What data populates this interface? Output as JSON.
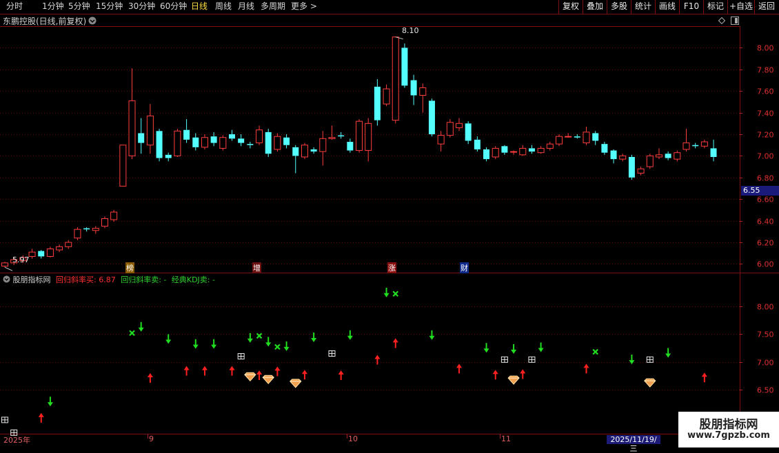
{
  "toolbar": {
    "left_items": [
      "分时",
      "1分钟",
      "5分钟",
      "15分钟",
      "30分钟",
      "60分钟",
      "日线",
      "周线",
      "月线",
      "多周期",
      "更多 >"
    ],
    "active": "日线",
    "right_items": [
      "复权",
      "叠加",
      "多股",
      "统计",
      "画线",
      "F10",
      "标记",
      "+自选",
      "返回"
    ]
  },
  "panel": {
    "title": "东鹏控股(日线,前复权)",
    "high_label": "8.10",
    "low_label": "5.97",
    "current_price_tag": "6.55",
    "event_markers": [
      {
        "text": "榜",
        "bg": "#8a5a00"
      },
      {
        "text": "增",
        "bg": "#6a1010"
      },
      {
        "text": "涨",
        "bg": "#8a1010"
      },
      {
        "text": "财",
        "bg": "#102a8a"
      }
    ]
  },
  "indicator": {
    "name": "股朋指标网",
    "buy_label": "回归斜率买: 6.87",
    "sell_label": "回归斜率卖: -",
    "kdj_label": "经典KDJ卖: -",
    "buy_color": "#ff3030",
    "sell_color": "#30d030"
  },
  "axis": {
    "date_labels": [
      "2025年",
      "9",
      "10",
      "11"
    ],
    "date_tag": "2025/11/19/三"
  },
  "watermark": {
    "line1": "股朋指标网",
    "line2": "www.7gpzb.com"
  },
  "chart_data": {
    "type": "candlestick",
    "title": "东鹏控股(日线,前复权)",
    "y_ticks": [
      8.0,
      7.8,
      7.6,
      7.4,
      7.2,
      7.0,
      6.8,
      6.6,
      6.4,
      6.2,
      6.0
    ],
    "ylim": [
      5.92,
      8.2
    ],
    "ind_y_ticks": [
      8.0,
      7.5,
      7.0,
      6.5
    ],
    "ind_ylim": [
      5.7,
      8.6
    ],
    "colors": {
      "up": "#ff3d3d",
      "down": "#54ffff"
    },
    "candles": [
      [
        5.98,
        6.01,
        6.02,
        5.97
      ],
      [
        6.01,
        6.04,
        6.06,
        5.99
      ],
      [
        6.03,
        6.06,
        6.08,
        6.01
      ],
      [
        6.07,
        6.11,
        6.14,
        6.05
      ],
      [
        6.12,
        6.07,
        6.13,
        6.05
      ],
      [
        6.07,
        6.14,
        6.16,
        6.06
      ],
      [
        6.13,
        6.16,
        6.18,
        6.11
      ],
      [
        6.16,
        6.2,
        6.22,
        6.14
      ],
      [
        6.24,
        6.32,
        6.34,
        6.22
      ],
      [
        6.33,
        6.32,
        6.34,
        6.3
      ],
      [
        6.31,
        6.33,
        6.35,
        6.28
      ],
      [
        6.35,
        6.42,
        6.44,
        6.33
      ],
      [
        6.41,
        6.48,
        6.5,
        6.39
      ],
      [
        6.72,
        7.1,
        7.1,
        6.72
      ],
      [
        7.0,
        7.51,
        7.81,
        6.97
      ],
      [
        7.21,
        7.12,
        7.35,
        7.02
      ],
      [
        7.1,
        7.37,
        7.48,
        7.02
      ],
      [
        7.23,
        6.98,
        7.25,
        6.95
      ],
      [
        7.01,
        6.98,
        7.03,
        6.95
      ],
      [
        7.0,
        7.23,
        7.25,
        6.99
      ],
      [
        7.24,
        7.15,
        7.34,
        7.12
      ],
      [
        7.17,
        7.08,
        7.21,
        7.05
      ],
      [
        7.08,
        7.17,
        7.2,
        7.06
      ],
      [
        7.18,
        7.12,
        7.22,
        7.09
      ],
      [
        7.07,
        7.17,
        7.19,
        7.05
      ],
      [
        7.2,
        7.16,
        7.24,
        7.14
      ],
      [
        7.16,
        7.12,
        7.2,
        7.09
      ],
      [
        7.11,
        7.1,
        7.13,
        7.07
      ],
      [
        7.12,
        7.24,
        7.28,
        7.1
      ],
      [
        7.22,
        7.02,
        7.25,
        6.99
      ],
      [
        7.06,
        7.18,
        7.21,
        7.04
      ],
      [
        7.17,
        7.1,
        7.2,
        7.07
      ],
      [
        7.08,
        7.0,
        7.1,
        6.84
      ],
      [
        6.99,
        7.1,
        7.12,
        6.97
      ],
      [
        7.06,
        7.04,
        7.08,
        7.02
      ],
      [
        7.04,
        7.16,
        7.23,
        6.91
      ],
      [
        7.16,
        7.17,
        7.28,
        7.15
      ],
      [
        7.19,
        7.18,
        7.22,
        7.16
      ],
      [
        7.13,
        7.05,
        7.16,
        7.03
      ],
      [
        7.05,
        7.32,
        7.34,
        7.03
      ],
      [
        7.05,
        7.3,
        7.35,
        6.95
      ],
      [
        7.64,
        7.33,
        7.71,
        7.28
      ],
      [
        7.48,
        7.62,
        7.66,
        7.46
      ],
      [
        7.33,
        8.1,
        8.1,
        7.3
      ],
      [
        8.0,
        7.65,
        8.04,
        7.63
      ],
      [
        7.7,
        7.56,
        7.75,
        7.47
      ],
      [
        7.56,
        7.63,
        7.67,
        7.4
      ],
      [
        7.51,
        7.2,
        7.53,
        7.18
      ],
      [
        7.11,
        7.19,
        7.23,
        7.04
      ],
      [
        7.19,
        7.31,
        7.34,
        7.17
      ],
      [
        7.26,
        7.3,
        7.35,
        7.23
      ],
      [
        7.3,
        7.14,
        7.32,
        7.11
      ],
      [
        7.15,
        7.06,
        7.18,
        7.04
      ],
      [
        7.06,
        6.97,
        7.08,
        6.95
      ],
      [
        6.99,
        7.07,
        7.09,
        6.97
      ],
      [
        7.09,
        7.03,
        7.1,
        7.01
      ],
      [
        7.04,
        7.04,
        7.05,
        7.01
      ],
      [
        7.01,
        7.07,
        7.1,
        7.0
      ],
      [
        7.07,
        7.04,
        7.1,
        7.02
      ],
      [
        7.03,
        7.07,
        7.09,
        7.02
      ],
      [
        7.07,
        7.11,
        7.13,
        7.05
      ],
      [
        7.11,
        7.18,
        7.2,
        7.09
      ],
      [
        7.18,
        7.18,
        7.21,
        7.17
      ],
      [
        7.18,
        7.17,
        7.2,
        7.16
      ],
      [
        7.12,
        7.22,
        7.27,
        7.1
      ],
      [
        7.21,
        7.14,
        7.23,
        7.1
      ],
      [
        7.11,
        7.03,
        7.13,
        7.01
      ],
      [
        7.05,
        6.97,
        7.06,
        6.93
      ],
      [
        6.97,
        7.0,
        7.02,
        6.95
      ],
      [
        6.99,
        6.8,
        7.01,
        6.78
      ],
      [
        6.84,
        6.88,
        6.9,
        6.82
      ],
      [
        6.9,
        7.0,
        7.02,
        6.88
      ],
      [
        6.99,
        7.01,
        7.07,
        6.97
      ],
      [
        7.02,
        6.98,
        7.04,
        6.96
      ],
      [
        6.97,
        7.03,
        7.05,
        6.95
      ],
      [
        7.06,
        7.12,
        7.25,
        7.04
      ],
      [
        7.1,
        7.09,
        7.12,
        7.07
      ],
      [
        7.09,
        7.13,
        7.15,
        7.07
      ],
      [
        7.07,
        6.99,
        7.15,
        6.95
      ]
    ],
    "ind_signals": [
      {
        "t": "square",
        "i": 0,
        "y": 5.95
      },
      {
        "t": "square",
        "i": 1,
        "y": 5.72
      },
      {
        "t": "down",
        "i": 5,
        "y": 6.27
      },
      {
        "t": "up",
        "i": 4,
        "y": 6.0
      },
      {
        "t": "x",
        "i": 14,
        "y": 7.52
      },
      {
        "t": "down",
        "i": 15,
        "y": 7.62
      },
      {
        "t": "up",
        "i": 16,
        "y": 6.72
      },
      {
        "t": "down",
        "i": 18,
        "y": 7.4
      },
      {
        "t": "up",
        "i": 20,
        "y": 6.85
      },
      {
        "t": "down",
        "i": 21,
        "y": 7.31
      },
      {
        "t": "up",
        "i": 22,
        "y": 6.85
      },
      {
        "t": "down",
        "i": 23,
        "y": 7.31
      },
      {
        "t": "up",
        "i": 25,
        "y": 6.85
      },
      {
        "t": "square",
        "i": 26,
        "y": 7.1
      },
      {
        "t": "down",
        "i": 27,
        "y": 7.42
      },
      {
        "t": "diamond",
        "i": 27,
        "y": 6.73
      },
      {
        "t": "x",
        "i": 28,
        "y": 7.47
      },
      {
        "t": "up",
        "i": 28,
        "y": 6.77
      },
      {
        "t": "down",
        "i": 29,
        "y": 7.35
      },
      {
        "t": "diamond",
        "i": 29,
        "y": 6.68
      },
      {
        "t": "x",
        "i": 30,
        "y": 7.27
      },
      {
        "t": "up",
        "i": 30,
        "y": 6.84
      },
      {
        "t": "down",
        "i": 31,
        "y": 7.27
      },
      {
        "t": "diamond",
        "i": 32,
        "y": 6.61
      },
      {
        "t": "up",
        "i": 33,
        "y": 6.78
      },
      {
        "t": "down",
        "i": 34,
        "y": 7.43
      },
      {
        "t": "square",
        "i": 36,
        "y": 7.15
      },
      {
        "t": "up",
        "i": 37,
        "y": 6.77
      },
      {
        "t": "down",
        "i": 38,
        "y": 7.47
      },
      {
        "t": "up",
        "i": 41,
        "y": 7.05
      },
      {
        "t": "down",
        "i": 42,
        "y": 8.24
      },
      {
        "t": "x",
        "i": 43,
        "y": 8.23
      },
      {
        "t": "up",
        "i": 43,
        "y": 7.35
      },
      {
        "t": "down",
        "i": 47,
        "y": 7.47
      },
      {
        "t": "up",
        "i": 50,
        "y": 6.89
      },
      {
        "t": "down",
        "i": 53,
        "y": 7.24
      },
      {
        "t": "up",
        "i": 54,
        "y": 6.78
      },
      {
        "t": "square",
        "i": 55,
        "y": 7.04
      },
      {
        "t": "down",
        "i": 56,
        "y": 7.22
      },
      {
        "t": "diamond",
        "i": 56,
        "y": 6.67
      },
      {
        "t": "up",
        "i": 57,
        "y": 6.79
      },
      {
        "t": "square",
        "i": 58,
        "y": 7.04
      },
      {
        "t": "down",
        "i": 59,
        "y": 7.25
      },
      {
        "t": "up",
        "i": 64,
        "y": 6.89
      },
      {
        "t": "x",
        "i": 65,
        "y": 7.18
      },
      {
        "t": "down",
        "i": 69,
        "y": 7.03
      },
      {
        "t": "square",
        "i": 71,
        "y": 7.04
      },
      {
        "t": "diamond",
        "i": 71,
        "y": 6.62
      },
      {
        "t": "down",
        "i": 73,
        "y": 7.15
      },
      {
        "t": "up",
        "i": 77,
        "y": 6.73
      }
    ]
  }
}
